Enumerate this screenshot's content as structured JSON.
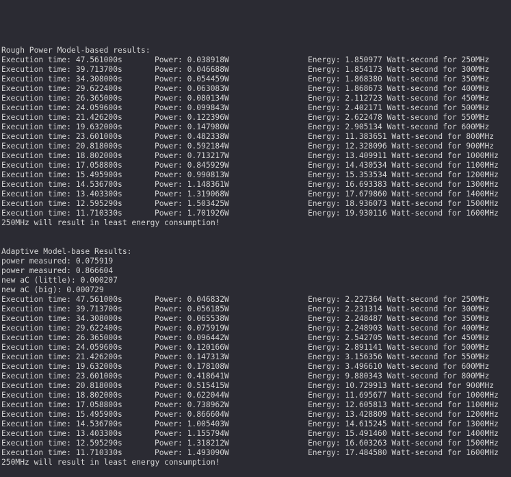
{
  "top_partial_line": "",
  "sections": [
    {
      "header": "Rough Power Model-based results:",
      "pre_lines": [],
      "rows": [
        {
          "time": "Execution time: 47.561000s",
          "power": "Power: 0.038918W",
          "energy": "Energy: 1.850977 Watt-second for 250MHz"
        },
        {
          "time": "Execution time: 39.713700s",
          "power": "Power: 0.046688W",
          "energy": "Energy: 1.854173 Watt-second for 300MHz"
        },
        {
          "time": "Execution time: 34.308000s",
          "power": "Power: 0.054459W",
          "energy": "Energy: 1.868380 Watt-second for 350MHz"
        },
        {
          "time": "Execution time: 29.622400s",
          "power": "Power: 0.063083W",
          "energy": "Energy: 1.868673 Watt-second for 400MHz"
        },
        {
          "time": "Execution time: 26.365000s",
          "power": "Power: 0.080134W",
          "energy": "Energy: 2.112723 Watt-second for 450MHz"
        },
        {
          "time": "Execution time: 24.059600s",
          "power": "Power: 0.099843W",
          "energy": "Energy: 2.402171 Watt-second for 500MHz"
        },
        {
          "time": "Execution time: 21.426200s",
          "power": "Power: 0.122396W",
          "energy": "Energy: 2.622478 Watt-second for 550MHz"
        },
        {
          "time": "Execution time: 19.632000s",
          "power": "Power: 0.147980W",
          "energy": "Energy: 2.905134 Watt-second for 600MHz"
        },
        {
          "time": "Execution time: 23.601000s",
          "power": "Power: 0.482338W",
          "energy": "Energy: 11.383651 Watt-second for 800MHz"
        },
        {
          "time": "Execution time: 20.818000s",
          "power": "Power: 0.592184W",
          "energy": "Energy: 12.328096 Watt-second for 900MHz"
        },
        {
          "time": "Execution time: 18.802000s",
          "power": "Power: 0.713217W",
          "energy": "Energy: 13.409911 Watt-second for 1000MHz"
        },
        {
          "time": "Execution time: 17.058800s",
          "power": "Power: 0.845929W",
          "energy": "Energy: 14.430534 Watt-second for 1100MHz"
        },
        {
          "time": "Execution time: 15.495900s",
          "power": "Power: 0.990813W",
          "energy": "Energy: 15.353534 Watt-second for 1200MHz"
        },
        {
          "time": "Execution time: 14.536700s",
          "power": "Power: 1.148361W",
          "energy": "Energy: 16.693383 Watt-second for 1300MHz"
        },
        {
          "time": "Execution time: 13.403300s",
          "power": "Power: 1.319068W",
          "energy": "Energy: 17.679860 Watt-second for 1400MHz"
        },
        {
          "time": "Execution time: 12.595290s",
          "power": "Power: 1.503425W",
          "energy": "Energy: 18.936073 Watt-second for 1500MHz"
        },
        {
          "time": "Execution time: 11.710330s",
          "power": "Power: 1.701926W",
          "energy": "Energy: 19.930116 Watt-second for 1600MHz"
        }
      ],
      "conclusion": "250MHz will result in least energy consumption!"
    },
    {
      "header": "Adaptive Model-base Results:",
      "pre_lines": [
        "power measured: 0.075919",
        "power measured: 0.866604",
        "new aC (little): 0.000207",
        "new aC (big): 0.000729"
      ],
      "rows": [
        {
          "time": "Execution time: 47.561000s",
          "power": "Power: 0.046832W",
          "energy": "Energy: 2.227364 Watt-second for 250MHz"
        },
        {
          "time": "Execution time: 39.713700s",
          "power": "Power: 0.056185W",
          "energy": "Energy: 2.231314 Watt-second for 300MHz"
        },
        {
          "time": "Execution time: 34.308000s",
          "power": "Power: 0.065538W",
          "energy": "Energy: 2.248487 Watt-second for 350MHz"
        },
        {
          "time": "Execution time: 29.622400s",
          "power": "Power: 0.075919W",
          "energy": "Energy: 2.248903 Watt-second for 400MHz"
        },
        {
          "time": "Execution time: 26.365000s",
          "power": "Power: 0.096442W",
          "energy": "Energy: 2.542705 Watt-second for 450MHz"
        },
        {
          "time": "Execution time: 24.059600s",
          "power": "Power: 0.120166W",
          "energy": "Energy: 2.891141 Watt-second for 500MHz"
        },
        {
          "time": "Execution time: 21.426200s",
          "power": "Power: 0.147313W",
          "energy": "Energy: 3.156356 Watt-second for 550MHz"
        },
        {
          "time": "Execution time: 19.632000s",
          "power": "Power: 0.178108W",
          "energy": "Energy: 3.496610 Watt-second for 600MHz"
        },
        {
          "time": "Execution time: 23.601000s",
          "power": "Power: 0.418641W",
          "energy": "Energy: 9.880343 Watt-second for 800MHz"
        },
        {
          "time": "Execution time: 20.818000s",
          "power": "Power: 0.515415W",
          "energy": "Energy: 10.729913 Watt-second for 900MHz"
        },
        {
          "time": "Execution time: 18.802000s",
          "power": "Power: 0.622044W",
          "energy": "Energy: 11.695677 Watt-second for 1000MHz"
        },
        {
          "time": "Execution time: 17.058800s",
          "power": "Power: 0.738962W",
          "energy": "Energy: 12.605813 Watt-second for 1100MHz"
        },
        {
          "time": "Execution time: 15.495900s",
          "power": "Power: 0.866604W",
          "energy": "Energy: 13.428809 Watt-second for 1200MHz"
        },
        {
          "time": "Execution time: 14.536700s",
          "power": "Power: 1.005403W",
          "energy": "Energy: 14.615245 Watt-second for 1300MHz"
        },
        {
          "time": "Execution time: 13.403300s",
          "power": "Power: 1.155794W",
          "energy": "Energy: 15.491460 Watt-second for 1400MHz"
        },
        {
          "time": "Execution time: 12.595290s",
          "power": "Power: 1.318212W",
          "energy": "Energy: 16.603263 Watt-second for 1500MHz"
        },
        {
          "time": "Execution time: 11.710330s",
          "power": "Power: 1.493090W",
          "energy": "Energy: 17.484580 Watt-second for 1600MHz"
        }
      ],
      "conclusion": "250MHz will result in least energy consumption!"
    }
  ],
  "colors": {
    "background": "#2b2b33",
    "text": "#d4d4d4"
  }
}
